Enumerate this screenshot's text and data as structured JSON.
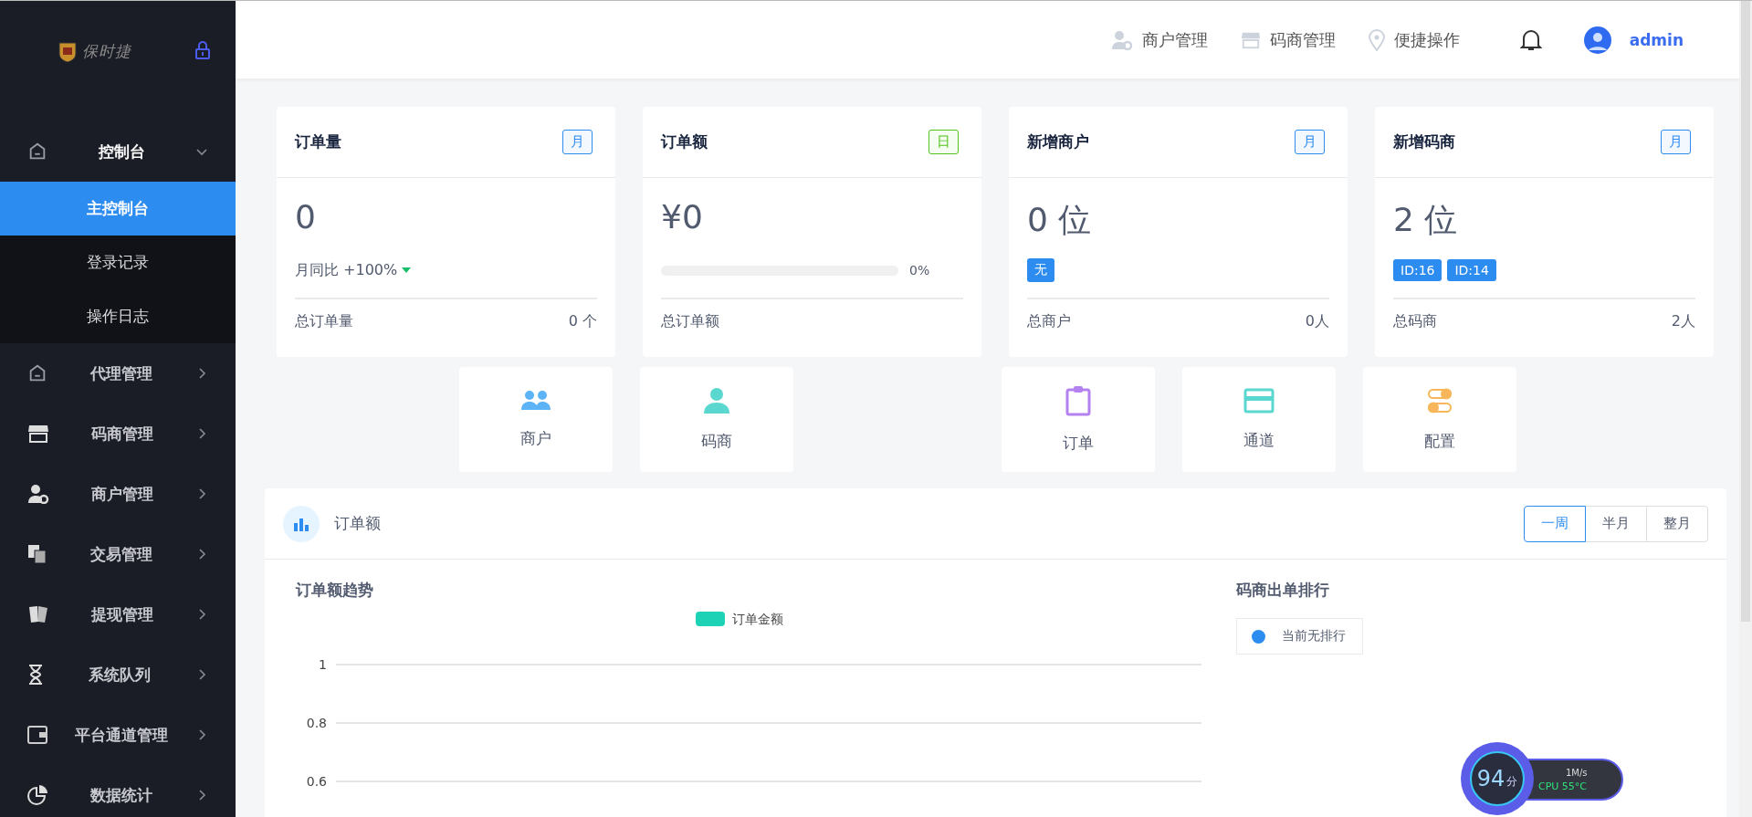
{
  "sidebar": {
    "logo": "保时捷",
    "items": [
      {
        "label": "控制台",
        "expanded": true,
        "children": [
          {
            "label": "主控制台",
            "selected": true
          },
          {
            "label": "登录记录",
            "selected": false
          },
          {
            "label": "操作日志",
            "selected": false
          }
        ]
      },
      {
        "label": "代理管理",
        "expanded": false
      },
      {
        "label": "码商管理",
        "expanded": false
      },
      {
        "label": "商户管理",
        "expanded": false
      },
      {
        "label": "交易管理",
        "expanded": false
      },
      {
        "label": "提现管理",
        "expanded": false
      },
      {
        "label": "系统队列",
        "expanded": false
      },
      {
        "label": "平台通道管理",
        "expanded": false
      },
      {
        "label": "数据统计",
        "expanded": false
      }
    ]
  },
  "header": {
    "links": [
      "商户管理",
      "码商管理",
      "便捷操作"
    ],
    "user": "admin"
  },
  "stat_cards": [
    {
      "title": "订单量",
      "period": "月",
      "color": "#2d8cf0",
      "kind": "trend",
      "value": "0",
      "trend": "月同比 +100%",
      "footer_label": "总订单量",
      "footer_value": "0 个"
    },
    {
      "title": "订单额",
      "period": "日",
      "color": "#52c41a",
      "kind": "progress",
      "value": "¥0",
      "level": 0,
      "progress_text": "0%",
      "footer_label": "总订单额"
    },
    {
      "title": "新增商户",
      "period": "月",
      "color": "#2d8cf0",
      "kind": "tags",
      "value": "0 位",
      "tags": [
        "无"
      ],
      "footer_label": "总商户",
      "footer_value": "0人"
    },
    {
      "title": "新增码商",
      "period": "月",
      "color": "#2d8cf0",
      "kind": "tags",
      "value": "2 位",
      "tags": [
        "ID:16",
        "ID:14"
      ],
      "footer_label": "总码商",
      "footer_value": "2人"
    }
  ],
  "shortcuts": [
    {
      "label": "商户",
      "color": "#5cb3f5"
    },
    {
      "label": "码商",
      "color": "#5ad8d0"
    },
    {
      "label": "订单",
      "color": "#b482f0"
    },
    {
      "label": "通道",
      "color": "#5ad8d0"
    },
    {
      "label": "配置",
      "color": "#f7b65a"
    }
  ],
  "panel": {
    "title": "订单额",
    "ranges": [
      {
        "label": "一周",
        "selected": true
      },
      {
        "label": "半月",
        "selected": false
      },
      {
        "label": "整月",
        "selected": false
      }
    ],
    "chart_title": "订单额趋势",
    "chart_data": {
      "type": "line",
      "ylim": [
        0.6,
        1
      ],
      "yticks": [
        0.6,
        0.8,
        1
      ],
      "series": [
        {
          "name": "订单金额",
          "color": "#1ed3b5"
        }
      ]
    },
    "ranking_title": "码商出单排行",
    "ranking_empty": "当前无排行"
  },
  "overlay_widget": {
    "score": "94",
    "score_unit": "分",
    "speed": "1M/s",
    "cpu": "CPU 55°C"
  }
}
